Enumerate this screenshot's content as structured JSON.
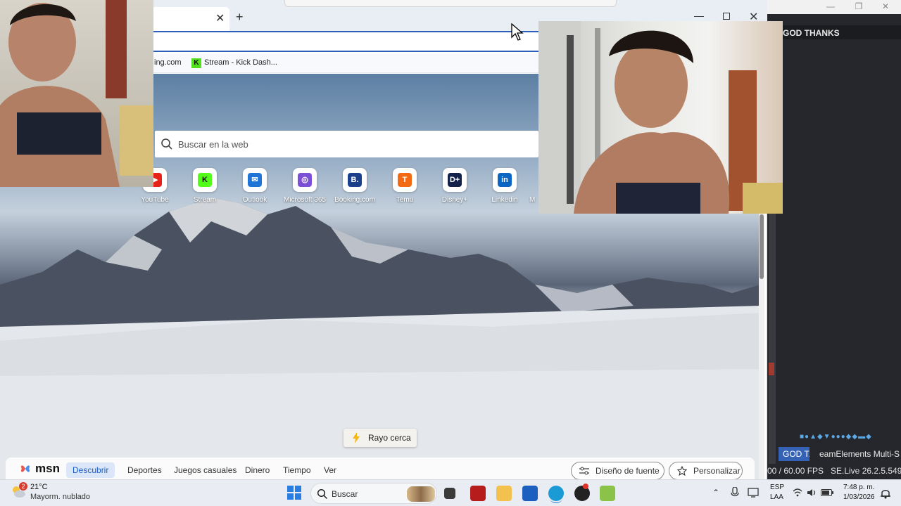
{
  "right_app": {
    "header": "GOD THANKS",
    "tray_icons": "■●▲◆▼●●●◆◆▬◆",
    "tab_active": "GOD T..",
    "tab_other": "eamElements Multi-S",
    "fps": "00 / 60.00 FPS",
    "version": "SE.Live 26.2.5.549",
    "win_min": "—",
    "win_max": "❐",
    "win_close": "✕"
  },
  "browser": {
    "tab_close": "✕",
    "new_tab": "+",
    "win_min": "—",
    "win_close": "✕",
    "favorites": [
      {
        "label": "ing.com"
      },
      {
        "label": "Stream - Kick Dash..."
      }
    ],
    "fav_k_glyph": "K"
  },
  "ntp": {
    "search_placeholder": "Buscar en la web",
    "tiles": [
      {
        "label": "YouTube",
        "glyph": "▶",
        "color": "#e62117"
      },
      {
        "label": "Stream",
        "glyph": "K",
        "color": "#111111"
      },
      {
        "label": "Outlook",
        "glyph": "✉",
        "color": "#1f74d6"
      },
      {
        "label": "Microsoft 365",
        "glyph": "◎",
        "color": "#7b4fd6"
      },
      {
        "label": "Booking.com",
        "glyph": "B.",
        "color": "#1c3f8c"
      },
      {
        "label": "Temu",
        "glyph": "T",
        "color": "#f26a13"
      },
      {
        "label": "Disney+",
        "glyph": "D+",
        "color": "#13224a"
      },
      {
        "label": "Linkedin",
        "glyph": "in",
        "color": "#0a66c2"
      },
      {
        "label": "M",
        "glyph": "",
        "color": "#ffffff"
      }
    ],
    "rayo_label": "Rayo cerca"
  },
  "msn": {
    "logo_text": "msn",
    "nav": [
      {
        "label": "Descubrir",
        "active": true
      },
      {
        "label": "Deportes"
      },
      {
        "label": "Juegos casuales"
      },
      {
        "label": "Dinero"
      },
      {
        "label": "Tiempo"
      },
      {
        "label": "Ver"
      }
    ],
    "font_design": "Diseño de fuente",
    "personalize": "Personalizar"
  },
  "taskbar": {
    "weather_badge": "2",
    "temperature": "21°C",
    "condition": "Mayorm. nublado",
    "search_label": "Buscar",
    "tray": {
      "chevron": "⌃",
      "lang_top": "ESP",
      "lang_bottom": "LAA",
      "time": "7:48 p. m.",
      "date": "1/03/2026"
    }
  }
}
